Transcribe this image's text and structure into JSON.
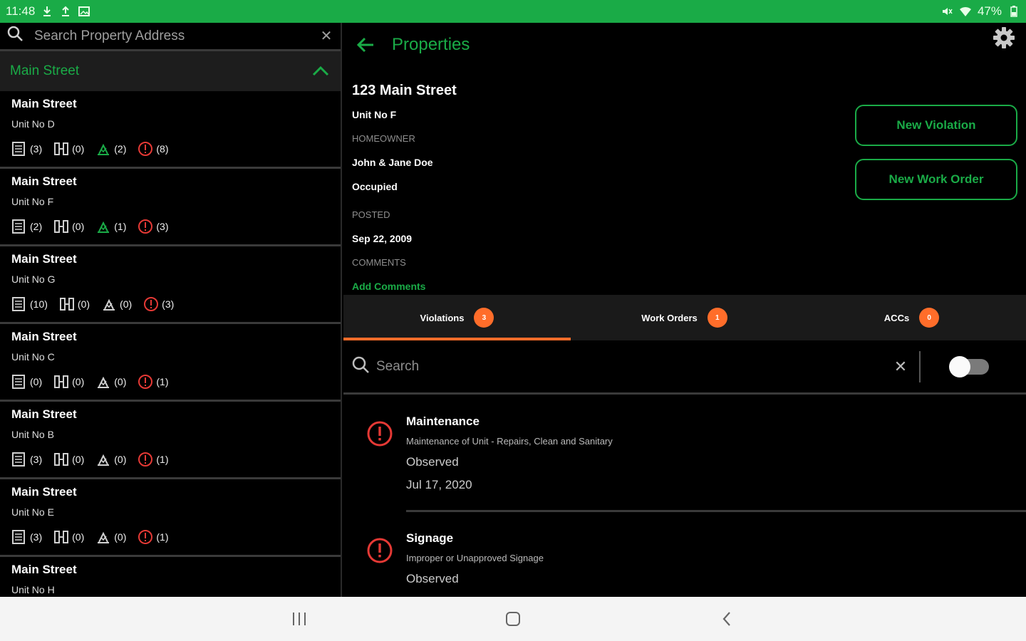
{
  "status_bar": {
    "time": "11:48",
    "battery": "47%"
  },
  "left_pane": {
    "search_placeholder": "Search Property Address",
    "group_title": "Main Street",
    "properties": [
      {
        "name": "Main Street",
        "unit": "Unit No D",
        "docs": "(3)",
        "work": "(0)",
        "acc": "(2)",
        "viol": "(8)"
      },
      {
        "name": "Main Street",
        "unit": "Unit No F",
        "docs": "(2)",
        "work": "(0)",
        "acc": "(1)",
        "viol": "(3)"
      },
      {
        "name": "Main Street",
        "unit": "Unit No G",
        "docs": "(10)",
        "work": "(0)",
        "acc": "(0)",
        "viol": "(3)"
      },
      {
        "name": "Main Street",
        "unit": "Unit No C",
        "docs": "(0)",
        "work": "(0)",
        "acc": "(0)",
        "viol": "(1)"
      },
      {
        "name": "Main Street",
        "unit": "Unit No B",
        "docs": "(3)",
        "work": "(0)",
        "acc": "(0)",
        "viol": "(1)"
      },
      {
        "name": "Main Street",
        "unit": "Unit No E",
        "docs": "(3)",
        "work": "(0)",
        "acc": "(0)",
        "viol": "(1)"
      },
      {
        "name": "Main Street",
        "unit": "Unit No H",
        "docs": "",
        "work": "",
        "acc": "",
        "viol": ""
      }
    ]
  },
  "header": {
    "title": "Properties"
  },
  "detail": {
    "address": "123 Main Street",
    "unit": "Unit No F",
    "homeowner_label": "HOMEOWNER",
    "homeowner": "John & Jane Doe",
    "occupancy": "Occupied",
    "posted_label": "POSTED",
    "posted": "Sep 22, 2009",
    "comments_label": "COMMENTS",
    "add_comments": "Add Comments",
    "new_violation": "New Violation",
    "new_work_order": "New Work Order"
  },
  "tabs": [
    {
      "label": "Violations",
      "count": "3"
    },
    {
      "label": "Work Orders",
      "count": "1"
    },
    {
      "label": "ACCs",
      "count": "0"
    }
  ],
  "list_search": {
    "placeholder": "Search"
  },
  "violations": [
    {
      "title": "Maintenance",
      "desc": "Maintenance of Unit - Repairs, Clean and Sanitary",
      "status": "Observed",
      "date": "Jul 17, 2020"
    },
    {
      "title": "Signage",
      "desc": "Improper or Unapproved Signage",
      "status": "Observed",
      "date": ""
    }
  ],
  "colors": {
    "accent_green": "#1aab47",
    "badge_orange": "#ff6d2a",
    "alert_red": "#e53935"
  }
}
